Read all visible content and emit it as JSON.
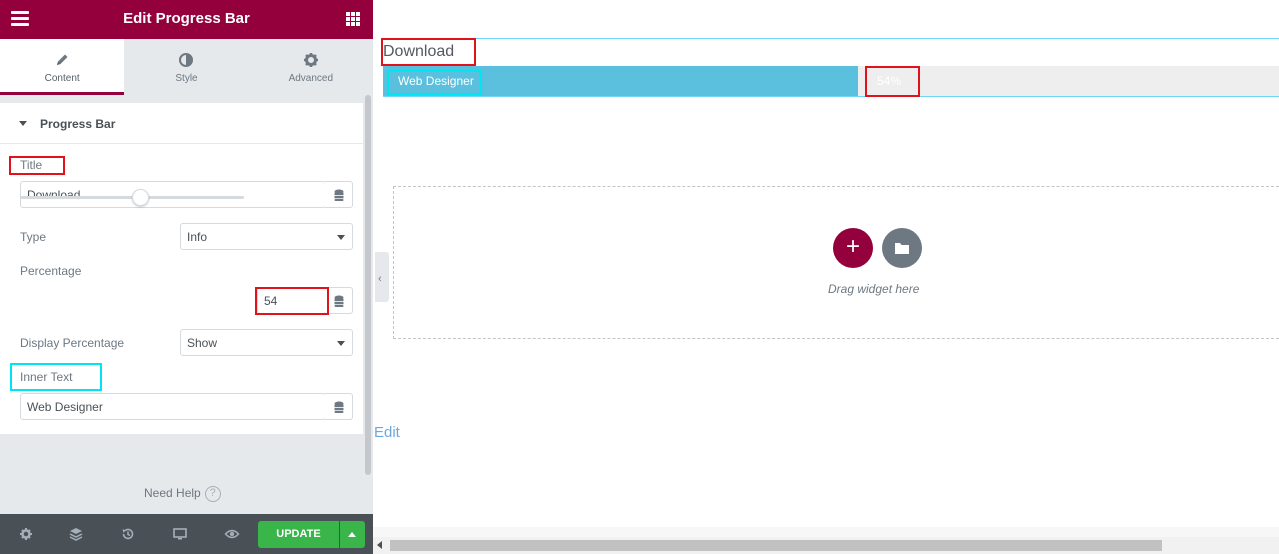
{
  "panel": {
    "header_title": "Edit Progress Bar",
    "tabs": [
      {
        "label": "Content",
        "icon": "pencil-icon"
      },
      {
        "label": "Style",
        "icon": "contrast-icon"
      },
      {
        "label": "Advanced",
        "icon": "gear-icon"
      }
    ],
    "section_title": "Progress Bar",
    "fields": {
      "title_label": "Title",
      "title_value": "Download",
      "type_label": "Type",
      "type_value": "Info",
      "percentage_label": "Percentage",
      "percentage_value": "54",
      "percentage_level": 54,
      "display_percentage_label": "Display Percentage",
      "display_percentage_value": "Show",
      "inner_text_label": "Inner Text",
      "inner_text_value": "Web Designer"
    },
    "need_help": "Need Help",
    "footer": {
      "update_label": "UPDATE",
      "icons": [
        "settings-icon",
        "layers-icon",
        "history-icon",
        "responsive-icon",
        "preview-eye-icon"
      ]
    }
  },
  "preview": {
    "progress_title": "Download",
    "inner_text": "Web Designer",
    "percent_text": "54%",
    "percent": 54,
    "drag_text": "Drag widget here",
    "edit_link": "Edit"
  },
  "colors": {
    "brand": "#93003c",
    "progress_fill": "#5bc0de",
    "update_green": "#39b54a",
    "highlight_red": "#e0131a",
    "highlight_cyan": "#00e5f2"
  }
}
